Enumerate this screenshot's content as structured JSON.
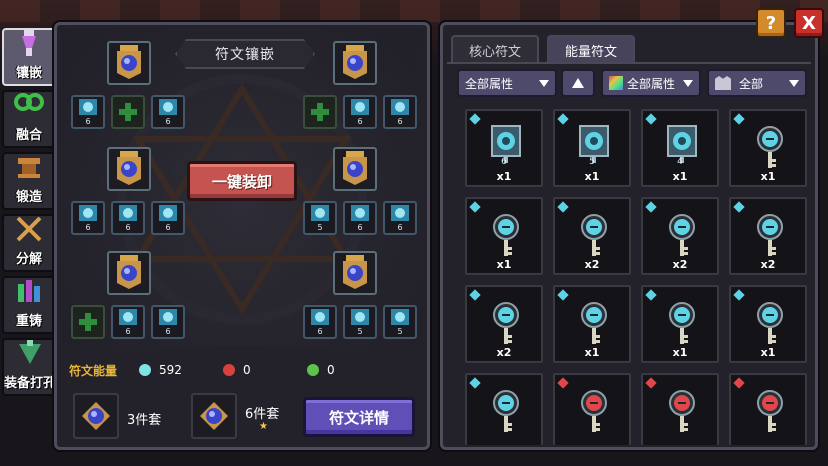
{
  "sidebar": {
    "items": [
      {
        "label": "镶嵌",
        "icon": "rune-inlay-icon",
        "active": true
      },
      {
        "label": "融合",
        "icon": "fusion-icon",
        "active": false
      },
      {
        "label": "锻造",
        "icon": "forge-icon",
        "active": false
      },
      {
        "label": "分解",
        "icon": "decompose-icon",
        "active": false
      },
      {
        "label": "重铸",
        "icon": "recast-icon",
        "active": false
      },
      {
        "label": "装备打孔",
        "icon": "socket-drill-icon",
        "active": false
      }
    ]
  },
  "left": {
    "title": "符文镶嵌",
    "unequip_label": "一键装卸",
    "core_slots": [
      {
        "group": "top-left"
      },
      {
        "group": "top-right"
      },
      {
        "group": "mid-left"
      },
      {
        "group": "mid-right"
      },
      {
        "group": "bottom-left"
      },
      {
        "group": "bottom-right"
      }
    ],
    "small_slot_numbers": {
      "top_left": [
        "6",
        "",
        "6"
      ],
      "top_right": [
        "",
        "6",
        "6"
      ],
      "mid_left": [
        "6",
        "6",
        "6"
      ],
      "mid_right": [
        "5",
        "6",
        "6"
      ],
      "bottom_left": [
        "",
        "6",
        "6"
      ],
      "bottom_right": [
        "6",
        "5",
        "5"
      ]
    },
    "energy": {
      "label": "符文能量",
      "items": [
        {
          "value": "592",
          "color": "#7fe3e6"
        },
        {
          "value": "0",
          "color": "#d9423c"
        },
        {
          "value": "0",
          "color": "#5fc24a"
        }
      ]
    },
    "sets": [
      {
        "label": "3件套"
      },
      {
        "label": "6件套",
        "star": "★"
      }
    ],
    "detail_label": "符文详情"
  },
  "right": {
    "tabs": [
      {
        "label": "核心符文",
        "active": false
      },
      {
        "label": "能量符文",
        "active": true
      }
    ],
    "filters": {
      "attr_label": "全部属性",
      "color_label": "全部属性",
      "type_label": "全部"
    },
    "runes": [
      {
        "count": "x1",
        "level": "6",
        "kind": "frame",
        "color": "#5fd3e6"
      },
      {
        "count": "x1",
        "level": "5",
        "kind": "frame",
        "color": "#5fd3e6"
      },
      {
        "count": "x1",
        "level": "4",
        "kind": "frame",
        "color": "#5fd3e6"
      },
      {
        "count": "x1",
        "level": "",
        "kind": "key-sword",
        "color": "#5fd3e6"
      },
      {
        "count": "x1",
        "level": "",
        "kind": "key-cross",
        "color": "#5fd3e6"
      },
      {
        "count": "x2",
        "level": "",
        "kind": "key-swirl",
        "color": "#5fd3e6"
      },
      {
        "count": "x2",
        "level": "",
        "kind": "key-ring",
        "color": "#5fd3e6"
      },
      {
        "count": "x2",
        "level": "",
        "kind": "key-spiral",
        "color": "#5fd3e6"
      },
      {
        "count": "x2",
        "level": "",
        "kind": "key-wave",
        "color": "#5fd3e6"
      },
      {
        "count": "x1",
        "level": "",
        "kind": "key-swirl",
        "color": "#5fd3e6"
      },
      {
        "count": "x1",
        "level": "",
        "kind": "key-arrow",
        "color": "#5fd3e6"
      },
      {
        "count": "x1",
        "level": "",
        "kind": "key-heart",
        "color": "#5fd3e6"
      },
      {
        "count": "",
        "level": "",
        "kind": "key-arrow",
        "color": "#5fd3e6"
      },
      {
        "count": "",
        "level": "",
        "kind": "key-red",
        "color": "#e0464a"
      },
      {
        "count": "",
        "level": "",
        "kind": "key-red",
        "color": "#e0464a"
      },
      {
        "count": "",
        "level": "",
        "kind": "key-red",
        "color": "#e0464a"
      }
    ]
  },
  "topbar": {
    "help": "?",
    "close": "X"
  }
}
